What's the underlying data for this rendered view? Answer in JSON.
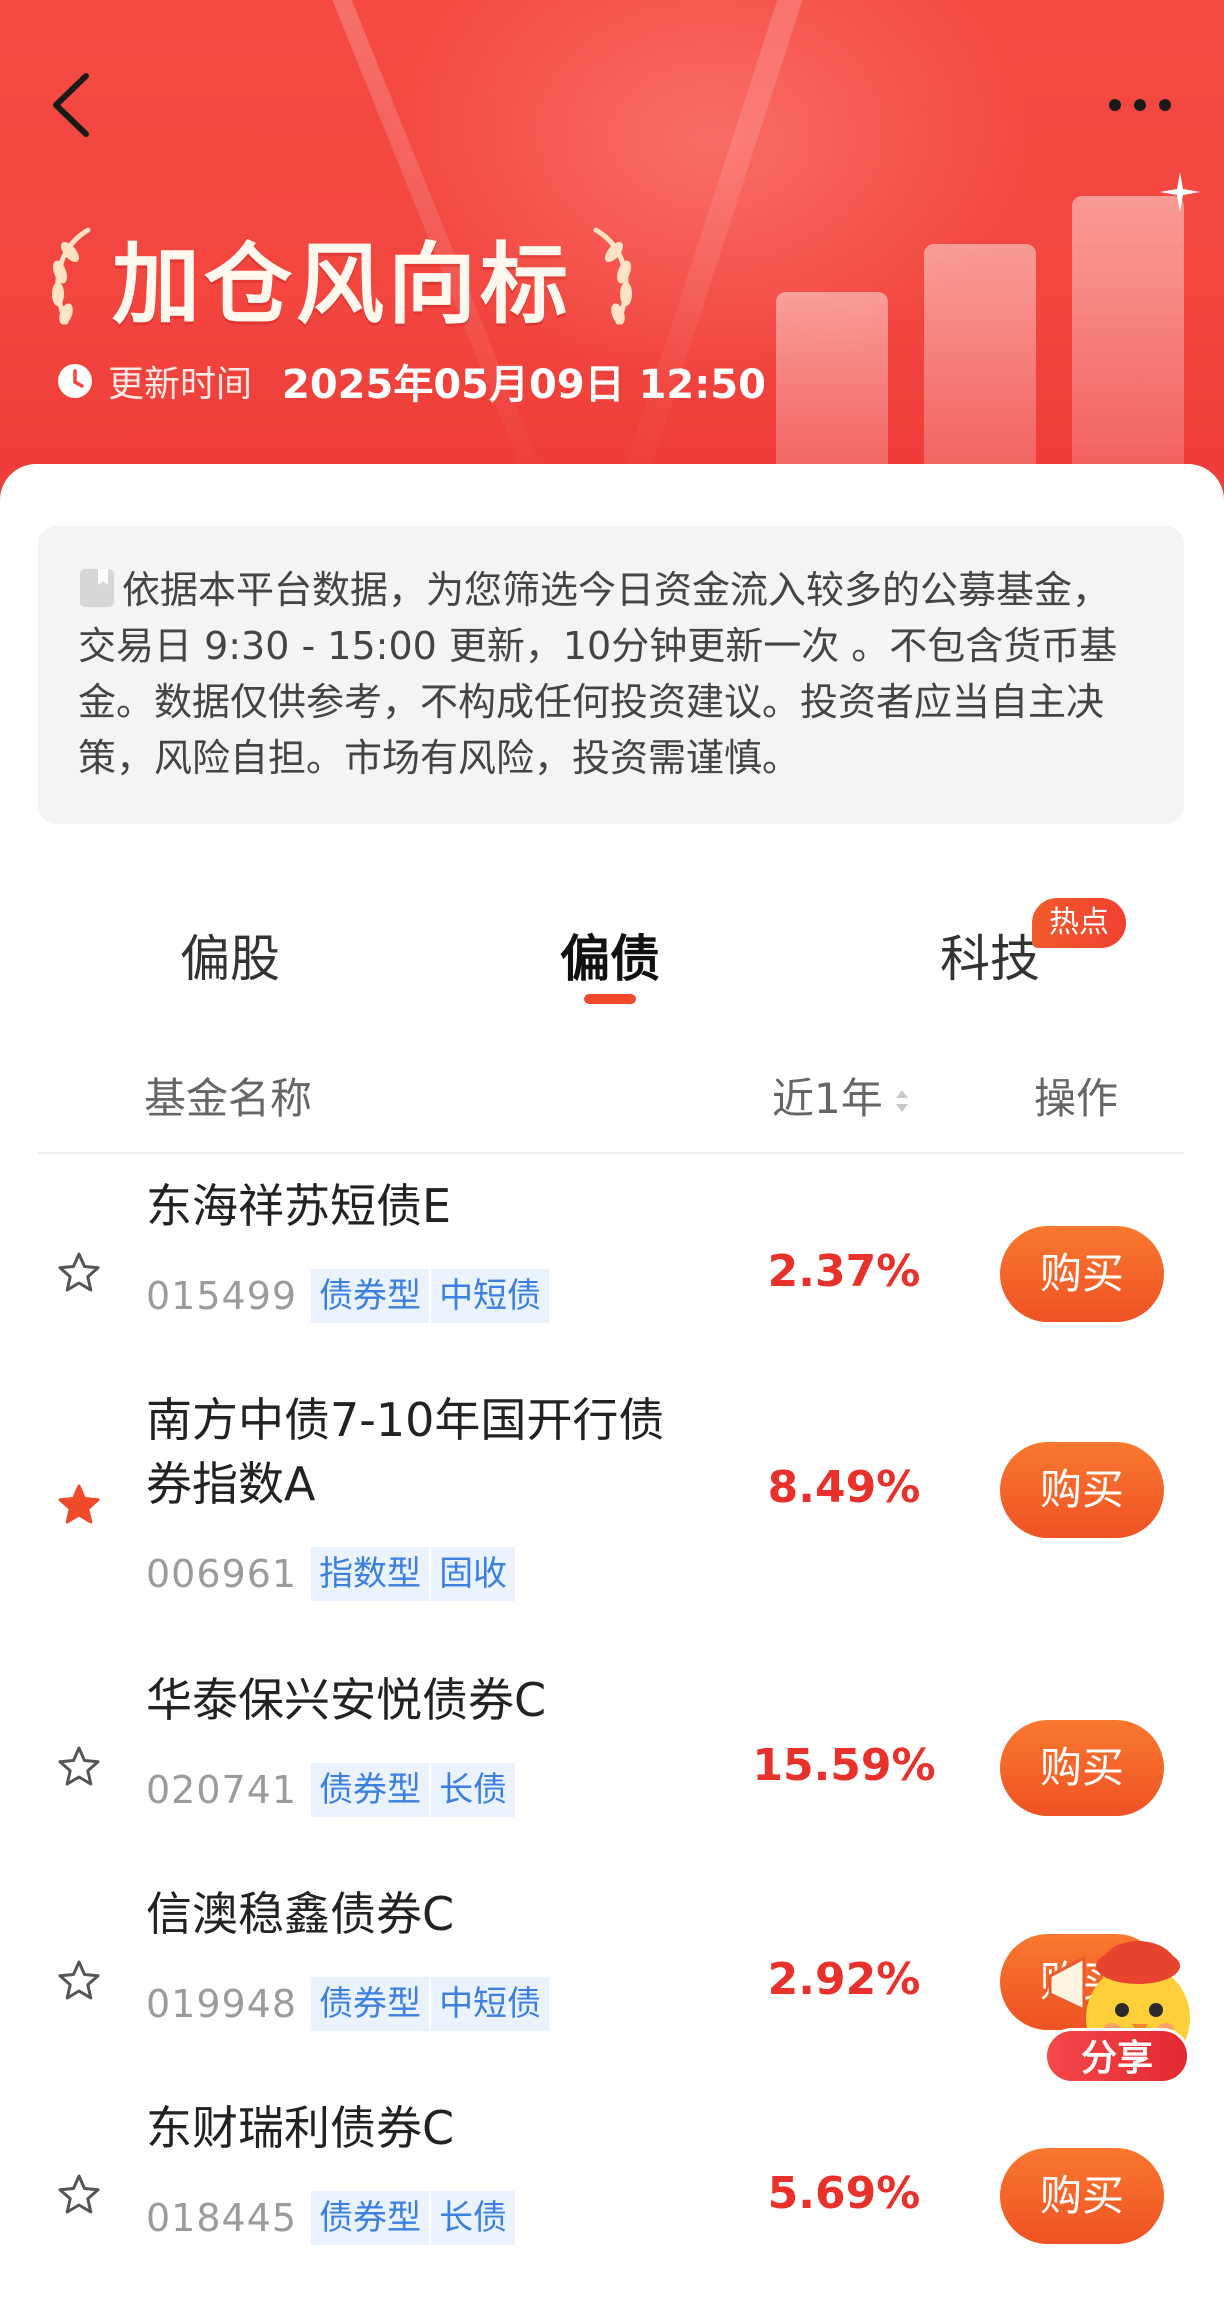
{
  "header": {
    "title": "加仓风向标",
    "update_label": "更新时间",
    "update_time": "2025年05月09日 12:50",
    "back_icon": "chevron-left-icon",
    "more_icon": "more-dots-icon"
  },
  "notice": {
    "icon": "document-icon",
    "text": "依据本平台数据，为您筛选今日资金流入较多的公募基金，交易日 9:30 - 15:00 更新，10分钟更新一次 。不包含货币基金。数据仅供参考，不构成任何投资建议。投资者应当自主决策，风险自担。市场有风险，投资需谨慎。"
  },
  "tabs": [
    {
      "label": "偏股",
      "active": false
    },
    {
      "label": "偏债",
      "active": true
    },
    {
      "label": "科技",
      "active": false,
      "badge": "热点"
    }
  ],
  "columns": {
    "name": "基金名称",
    "return": "近1年",
    "action": "操作"
  },
  "funds": [
    {
      "name": "东海祥苏短债E",
      "code": "015499",
      "tags": [
        "债券型",
        "中短债"
      ],
      "return": "2.37%",
      "starred": false,
      "action": "购买"
    },
    {
      "name": "南方中债7-10年国开行债券指数A",
      "code": "006961",
      "tags": [
        "指数型",
        "固收"
      ],
      "return": "8.49%",
      "starred": true,
      "action": "购买"
    },
    {
      "name": "华泰保兴安悦债券C",
      "code": "020741",
      "tags": [
        "债券型",
        "长债"
      ],
      "return": "15.59%",
      "starred": false,
      "action": "购买"
    },
    {
      "name": "信澳稳鑫债券C",
      "code": "019948",
      "tags": [
        "债券型",
        "中短债"
      ],
      "return": "2.92%",
      "starred": false,
      "action": "购买"
    },
    {
      "name": "东财瑞利债券C",
      "code": "018445",
      "tags": [
        "债券型",
        "长债"
      ],
      "return": "5.69%",
      "starred": false,
      "action": "购买"
    }
  ],
  "share": {
    "label": "分享",
    "icon": "chick-mascot-icon"
  },
  "colors": {
    "brand_red": "#f2463f",
    "return_red": "#e8312a",
    "buy_orange": "#f26a2a",
    "tag_blue": "#3b7fe0",
    "star_active": "#f04a2b"
  }
}
